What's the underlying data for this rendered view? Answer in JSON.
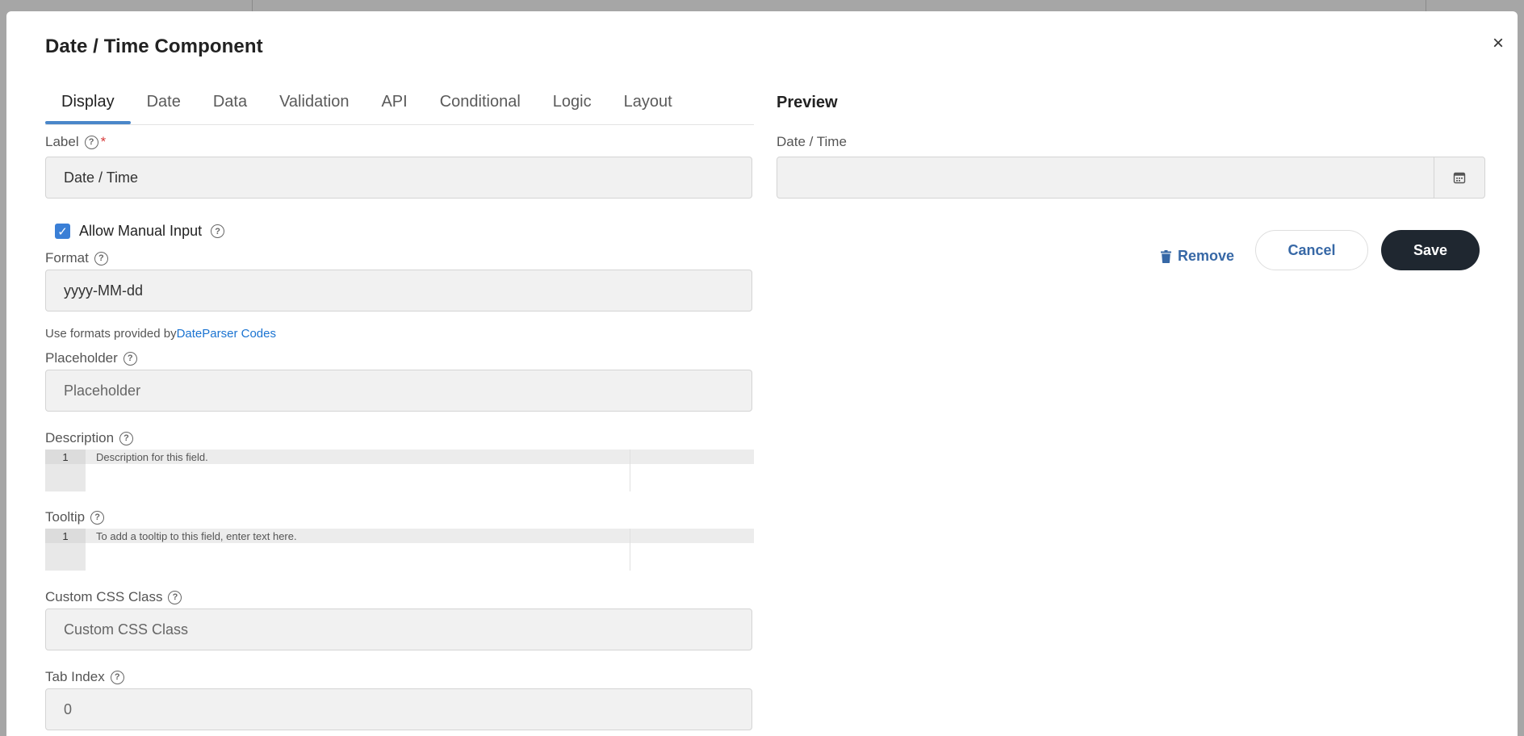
{
  "modal": {
    "title": "Date / Time Component",
    "close_symbol": "×"
  },
  "tabs": [
    {
      "label": "Display",
      "active": true
    },
    {
      "label": "Date"
    },
    {
      "label": "Data"
    },
    {
      "label": "Validation"
    },
    {
      "label": "API"
    },
    {
      "label": "Conditional"
    },
    {
      "label": "Logic"
    },
    {
      "label": "Layout"
    }
  ],
  "form": {
    "label": {
      "title": "Label",
      "required_mark": "*",
      "value": "Date / Time"
    },
    "allow_manual_input": {
      "label": "Allow Manual Input",
      "checked": true
    },
    "format": {
      "title": "Format",
      "value": "yyyy-MM-dd"
    },
    "format_hint": {
      "text": "Use formats provided by",
      "link": "DateParser Codes"
    },
    "placeholder": {
      "title": "Placeholder",
      "value": "Placeholder"
    },
    "description": {
      "title": "Description",
      "line_number": "1",
      "text": "Description for this field."
    },
    "tooltip": {
      "title": "Tooltip",
      "line_number": "1",
      "text": "To add a tooltip to this field, enter text here."
    },
    "custom_css": {
      "title": "Custom CSS Class",
      "value": "Custom CSS Class"
    },
    "tab_index": {
      "title": "Tab Index",
      "value": "0"
    }
  },
  "preview": {
    "title": "Preview",
    "field_label": "Date / Time",
    "calendar_icon": "calendar-icon"
  },
  "actions": {
    "remove": "Remove",
    "cancel": "Cancel",
    "save": "Save"
  },
  "colors": {
    "accent": "#4a87c9",
    "link": "#1a73d1",
    "save_bg": "#1f2730",
    "required": "#d63b3b"
  }
}
